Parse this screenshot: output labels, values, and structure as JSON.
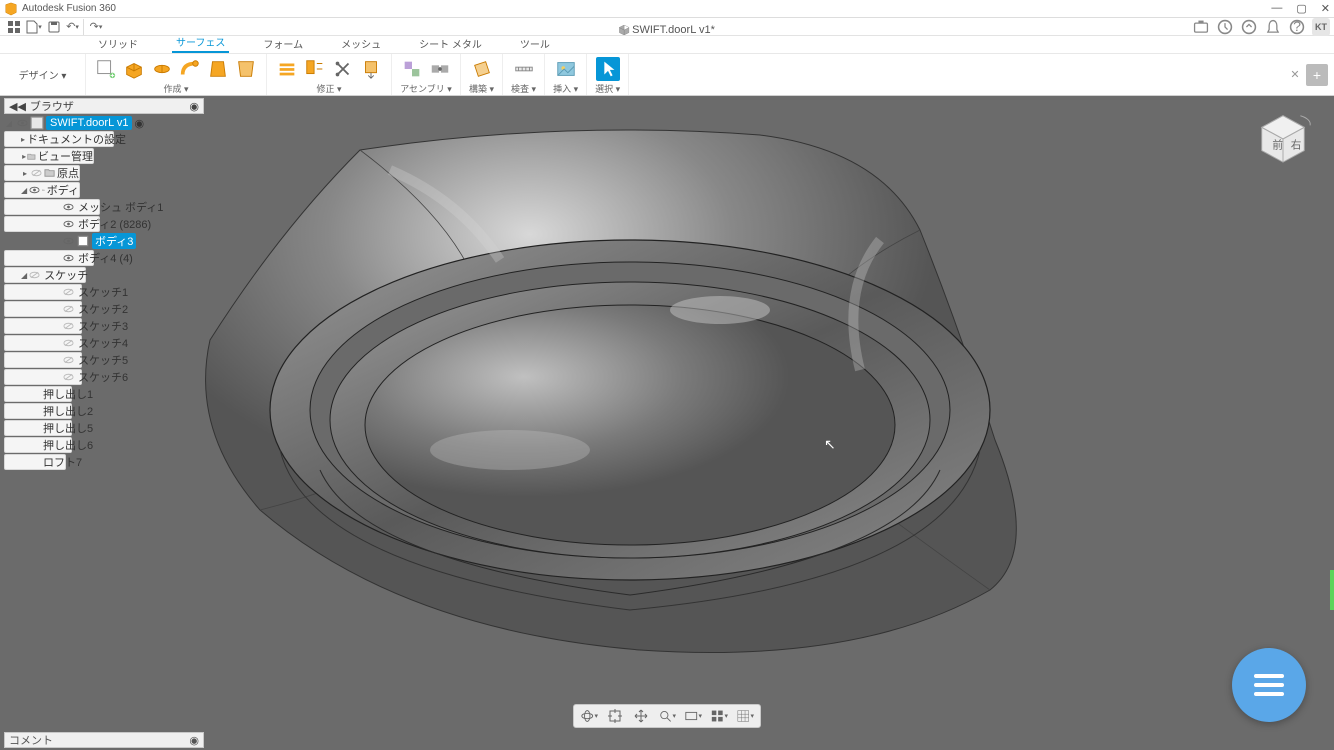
{
  "app_title": "Autodesk Fusion 360",
  "document_name": "SWIFT.doorL v1*",
  "user_initials": "KT",
  "design_dropdown": "デザイン ▾",
  "tabs": {
    "solid": "ソリッド",
    "surface": "サーフェス",
    "form": "フォーム",
    "mesh": "メッシュ",
    "sheet_metal": "シート メタル",
    "tools": "ツール"
  },
  "ribbon_groups": {
    "create": "作成 ▾",
    "modify": "修正 ▾",
    "assembly": "アセンブリ ▾",
    "construct": "構築 ▾",
    "inspect": "検査 ▾",
    "insert": "挿入 ▾",
    "select": "選択 ▾"
  },
  "browser": {
    "header": "ブラウザ",
    "root": "SWIFT.doorL v1",
    "doc_settings": "ドキュメントの設定",
    "view_mgmt": "ビュー管理",
    "origin": "原点",
    "bodies": "ボディ",
    "body_items": [
      "メッシュ ボディ1",
      "ボディ2 (8286)",
      "ボディ3",
      "ボディ4 (4)"
    ],
    "sketches": "スケッチ",
    "sketch_items": [
      "スケッチ1",
      "スケッチ2",
      "スケッチ3",
      "スケッチ4",
      "スケッチ5",
      "スケッチ6"
    ],
    "features": [
      "押し出し1",
      "押し出し2",
      "押し出し5",
      "押し出し6",
      "ロフト7"
    ]
  },
  "comments_label": "コメント",
  "viewcube_faces": {
    "front": "前",
    "right": "右"
  }
}
